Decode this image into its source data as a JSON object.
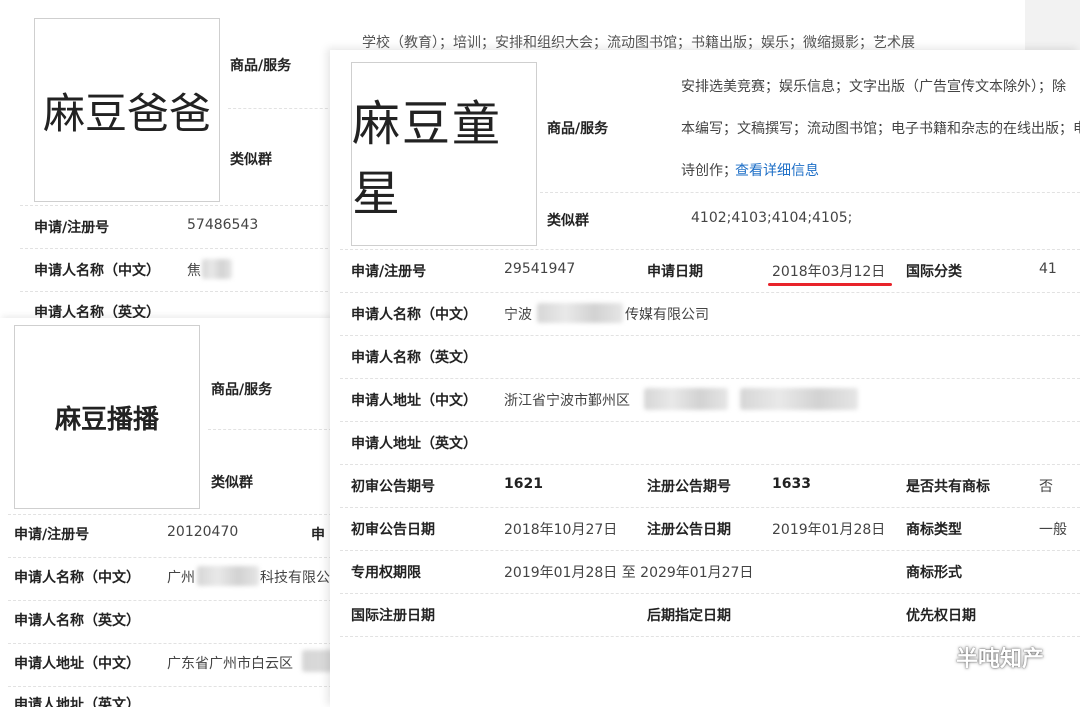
{
  "card_a": {
    "logo_text": "麻豆爸爸",
    "labels": {
      "goods": "商品/服务",
      "similar": "类似群",
      "reg_no": "申请/注册号",
      "applicant_cn": "申请人名称（中文）",
      "applicant_en": "申请人名称（英文）"
    },
    "values": {
      "reg_no": "57486543",
      "applicant_cn": "焦"
    }
  },
  "card_b": {
    "top_description": "学校（教育）；培训；安排和组织大会；流动图书馆；书籍出版；娱乐；微缩摄影；艺术展",
    "logo_text": "麻豆童星",
    "labels": {
      "goods": "商品/服务",
      "similar": "类似群",
      "reg_no": "申请/注册号",
      "apply_date": "申请日期",
      "intl_class": "国际分类",
      "applicant_cn": "申请人名称（中文）",
      "applicant_en": "申请人名称（英文）",
      "address_cn": "申请人地址（中文）",
      "address_en": "申请人地址（英文）",
      "prelim_issue": "初审公告期号",
      "reg_issue": "注册公告期号",
      "shared": "是否共有商标",
      "prelim_date": "初审公告日期",
      "reg_date": "注册公告日期",
      "mark_type": "商标类型",
      "exclusive_period": "专用权期限",
      "mark_form": "商标形式",
      "intl_reg_date": "国际注册日期",
      "later_date": "后期指定日期",
      "priority_date": "优先权日期"
    },
    "goods_lines": [
      "安排选美竞赛；娱乐信息；文字出版（广告宣传文本除外）；除",
      "本编写；文稿撰写；流动图书馆；电子书籍和杂志的在线出版；电",
      "诗创作；"
    ],
    "detail_link": "查看详细信息",
    "values": {
      "similar": "4102;4103;4104;4105;",
      "reg_no": "29541947",
      "apply_date": "2018年03月12日",
      "intl_class": "41",
      "applicant_cn_prefix": "宁波",
      "applicant_cn_suffix": "传媒有限公司",
      "address_cn_prefix": "浙江省宁波市鄞州区",
      "prelim_issue": "1621",
      "reg_issue": "1633",
      "shared": "否",
      "prelim_date": "2018年10月27日",
      "reg_date": "2019年01月28日",
      "mark_type": "一般",
      "exclusive_period": "2019年01月28日 至 2029年01月27日"
    },
    "highlight_color": "#e8232a",
    "link_color": "#1e6fc7"
  },
  "card_c": {
    "logo_text": "麻豆播播",
    "labels": {
      "goods": "商品/服务",
      "similar": "类似群",
      "reg_no": "申请/注册号",
      "reg_no_cut": "申",
      "applicant_cn": "申请人名称（中文）",
      "applicant_en": "申请人名称（英文）",
      "address_cn": "申请人地址（中文）",
      "address_en": "申请人地址（英文）"
    },
    "values": {
      "reg_no": "20120470",
      "applicant_cn_prefix": "广州",
      "applicant_cn_suffix": "科技有限公",
      "address_cn_prefix": "广东省广州市白云区"
    }
  },
  "watermark": {
    "text": "半吨知产",
    "icon": "wechat-icon"
  }
}
